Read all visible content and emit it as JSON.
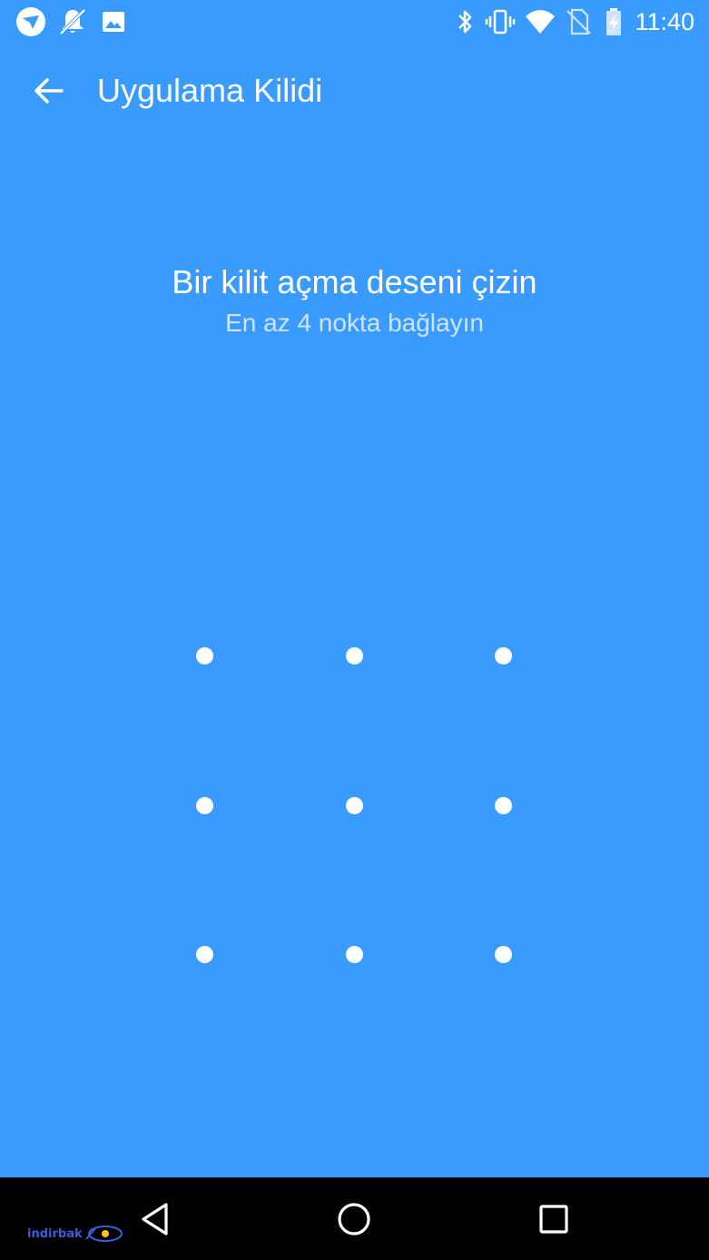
{
  "status_bar": {
    "time": "11:40",
    "left_icons": [
      "messenger-app-icon",
      "notifications-off-icon",
      "image-icon"
    ],
    "right_icons": [
      "bluetooth-icon",
      "vibrate-icon",
      "wifi-icon",
      "no-sim-icon",
      "battery-charging-icon"
    ]
  },
  "app_bar": {
    "title": "Uygulama Kilidi",
    "back_icon": "arrow-back-icon"
  },
  "prompt": {
    "title": "Bir kilit açma deseni çizin",
    "subtitle": "En az 4 nokta bağlayın"
  },
  "pattern": {
    "rows": 3,
    "cols": 3
  },
  "nav_bar": {
    "buttons": [
      "back-triangle-icon",
      "home-circle-icon",
      "recents-square-icon"
    ],
    "watermark": "indirbak"
  },
  "colors": {
    "background": "#3a9bff",
    "text_primary": "#ffffff",
    "text_secondary": "#cfe4ff",
    "nav_bar": "#000000"
  }
}
